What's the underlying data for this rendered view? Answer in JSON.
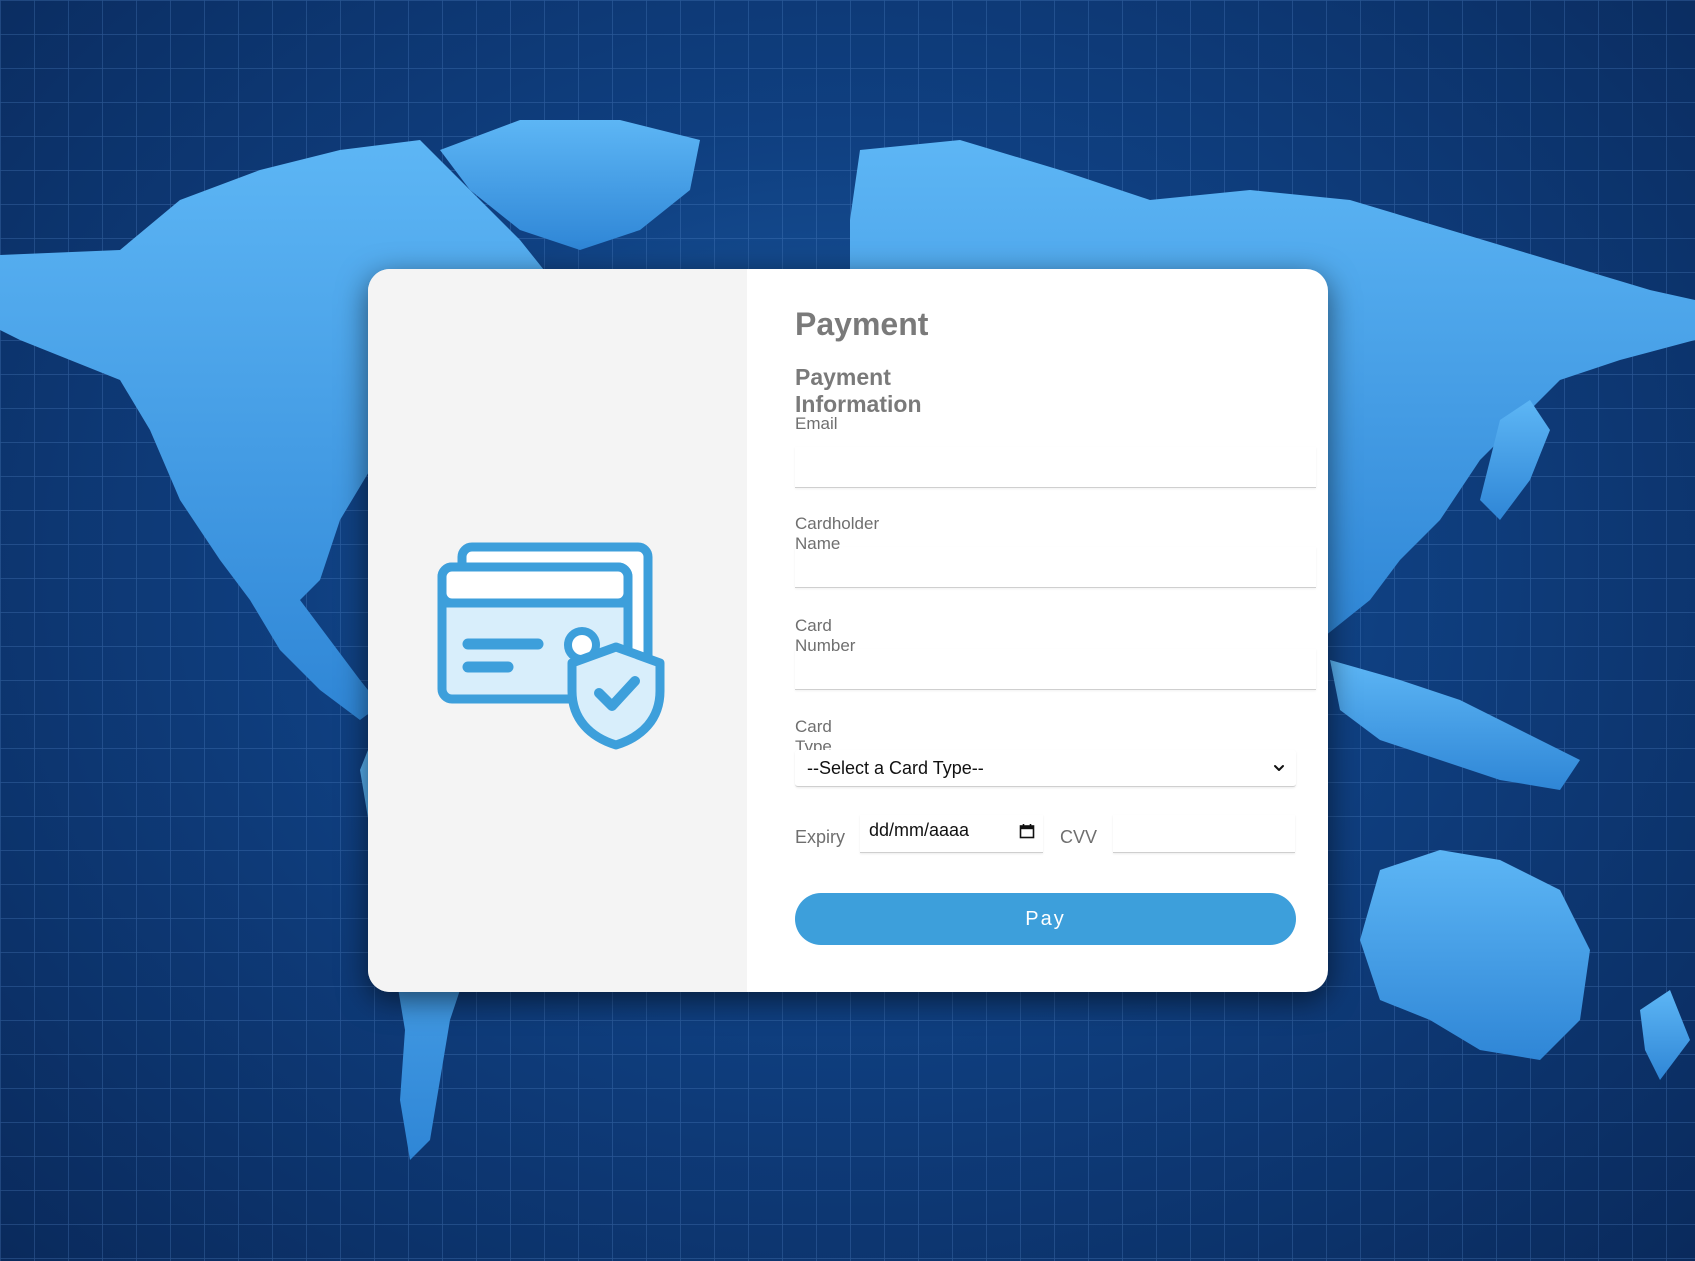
{
  "form": {
    "title": "Payment",
    "subtitle": "Payment Information",
    "email_label": "Email",
    "email_value": "",
    "cardholder_label": "Cardholder Name",
    "cardholder_value": "",
    "card_number_label": "Card Number",
    "card_number_value": "",
    "card_type_label": "Card Type",
    "card_type_selected": "--Select a Card Type--",
    "expiry_label": "Expiry",
    "expiry_placeholder": "dd/mm/aaaa",
    "cvv_label": "CVV",
    "cvv_value": "",
    "pay_label": "Pay"
  },
  "icons": {
    "illustration": "credit-card-shield-icon",
    "calendar": "calendar-icon",
    "dropdown": "chevron-down-icon"
  },
  "colors": {
    "accent": "#3d9fdb",
    "background_dark": "#0f3f80",
    "map_land": "#4aa9ef",
    "panel": "#f4f4f4",
    "text_muted": "#7a7a7a"
  }
}
